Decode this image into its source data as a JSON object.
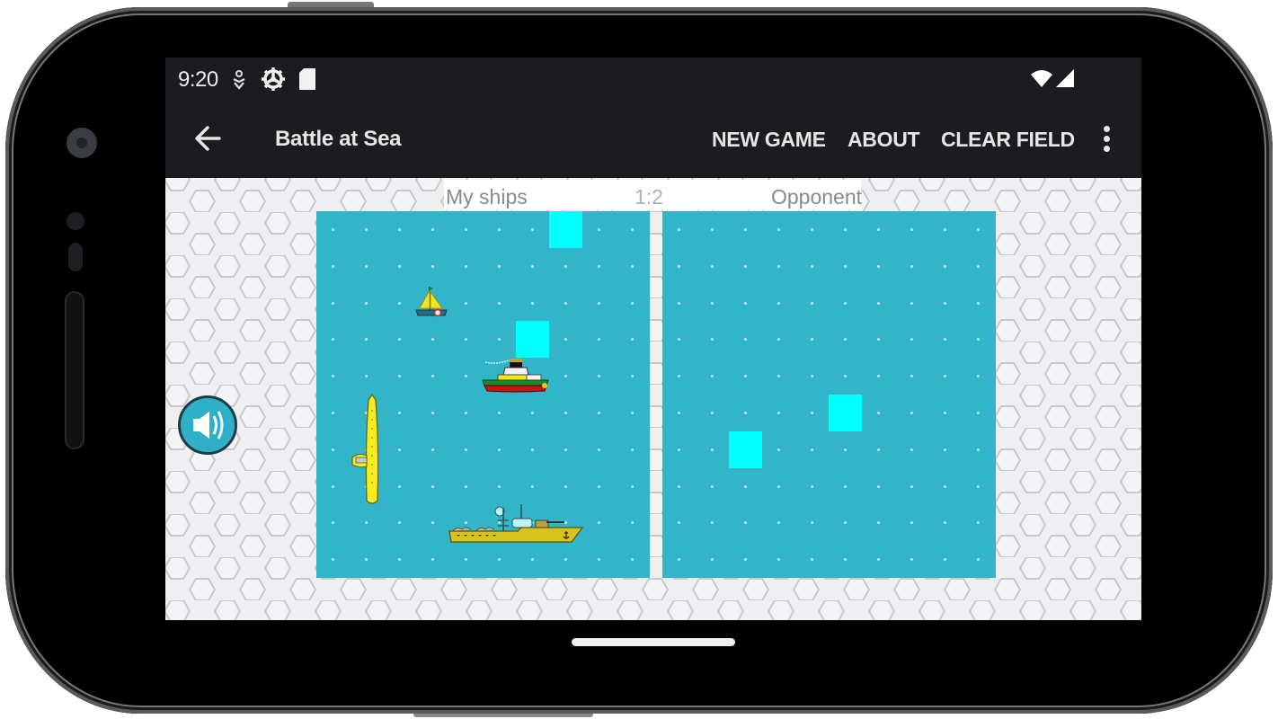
{
  "statusbar": {
    "time": "9:20",
    "icons": [
      "accessibility-icon",
      "settings-gear-icon",
      "sd-card-icon",
      "wifi-icon",
      "cell-signal-icon"
    ]
  },
  "appbar": {
    "back_icon": "arrow-left-icon",
    "title": "Battle at Sea",
    "actions": [
      {
        "label": "NEW GAME"
      },
      {
        "label": "ABOUT"
      },
      {
        "label": "CLEAR FIELD"
      }
    ],
    "overflow_icon": "more-vert-icon"
  },
  "game": {
    "my_label": "My ships",
    "score": "1:2",
    "opponent_label": "Opponent",
    "grid": {
      "cols": 10,
      "rows": 10
    },
    "colors": {
      "sea": "#33b5c9",
      "hit": "#00ffff",
      "dot": "#bfe8ee"
    },
    "my_board": {
      "shots": [
        {
          "col": 7,
          "row": 0
        },
        {
          "col": 6,
          "row": 3
        }
      ],
      "ships": [
        {
          "type": "sailboat",
          "col": 3,
          "row": 2,
          "length": 1,
          "orientation": "horizontal"
        },
        {
          "type": "tugboat",
          "col": 5,
          "row": 4,
          "length": 2,
          "orientation": "horizontal"
        },
        {
          "type": "submarine",
          "col": 1,
          "row": 5,
          "length": 3,
          "orientation": "vertical"
        },
        {
          "type": "battleship",
          "col": 4,
          "row": 8,
          "length": 4,
          "orientation": "horizontal"
        }
      ]
    },
    "opponent_board": {
      "shots": [
        {
          "col": 5,
          "row": 5
        },
        {
          "col": 2,
          "row": 6
        }
      ]
    },
    "sound_icon": "speaker-volume-icon"
  },
  "navbar": {
    "home_indicator": "home-pill"
  }
}
